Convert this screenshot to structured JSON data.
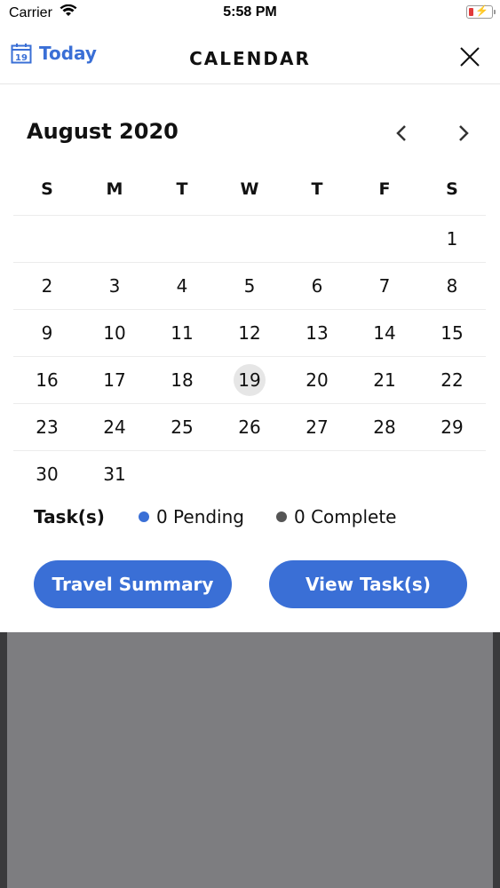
{
  "status": {
    "carrier": "Carrier",
    "time": "5:58 PM"
  },
  "header": {
    "today_label": "Today",
    "title": "CALENDAR",
    "today_icon_day": "19"
  },
  "calendar": {
    "month_label": "August 2020",
    "weekdays": [
      "S",
      "M",
      "T",
      "W",
      "T",
      "F",
      "S"
    ],
    "weeks": [
      [
        "",
        "",
        "",
        "",
        "",
        "",
        "1"
      ],
      [
        "2",
        "3",
        "4",
        "5",
        "6",
        "7",
        "8"
      ],
      [
        "9",
        "10",
        "11",
        "12",
        "13",
        "14",
        "15"
      ],
      [
        "16",
        "17",
        "18",
        "19",
        "20",
        "21",
        "22"
      ],
      [
        "23",
        "24",
        "25",
        "26",
        "27",
        "28",
        "29"
      ],
      [
        "30",
        "31",
        "",
        "",
        "",
        "",
        ""
      ]
    ],
    "selected_day": "19"
  },
  "tasks": {
    "label": "Task(s)",
    "pending_text": "0 Pending",
    "complete_text": "0 Complete",
    "pending_color": "#3a6fd6",
    "complete_color": "#555555"
  },
  "buttons": {
    "travel_summary": "Travel Summary",
    "view_tasks": "View Task(s)"
  },
  "colors": {
    "accent": "#3a6fd6",
    "selected_bg": "#e6e6e6",
    "overlay": "#7d7d80"
  }
}
